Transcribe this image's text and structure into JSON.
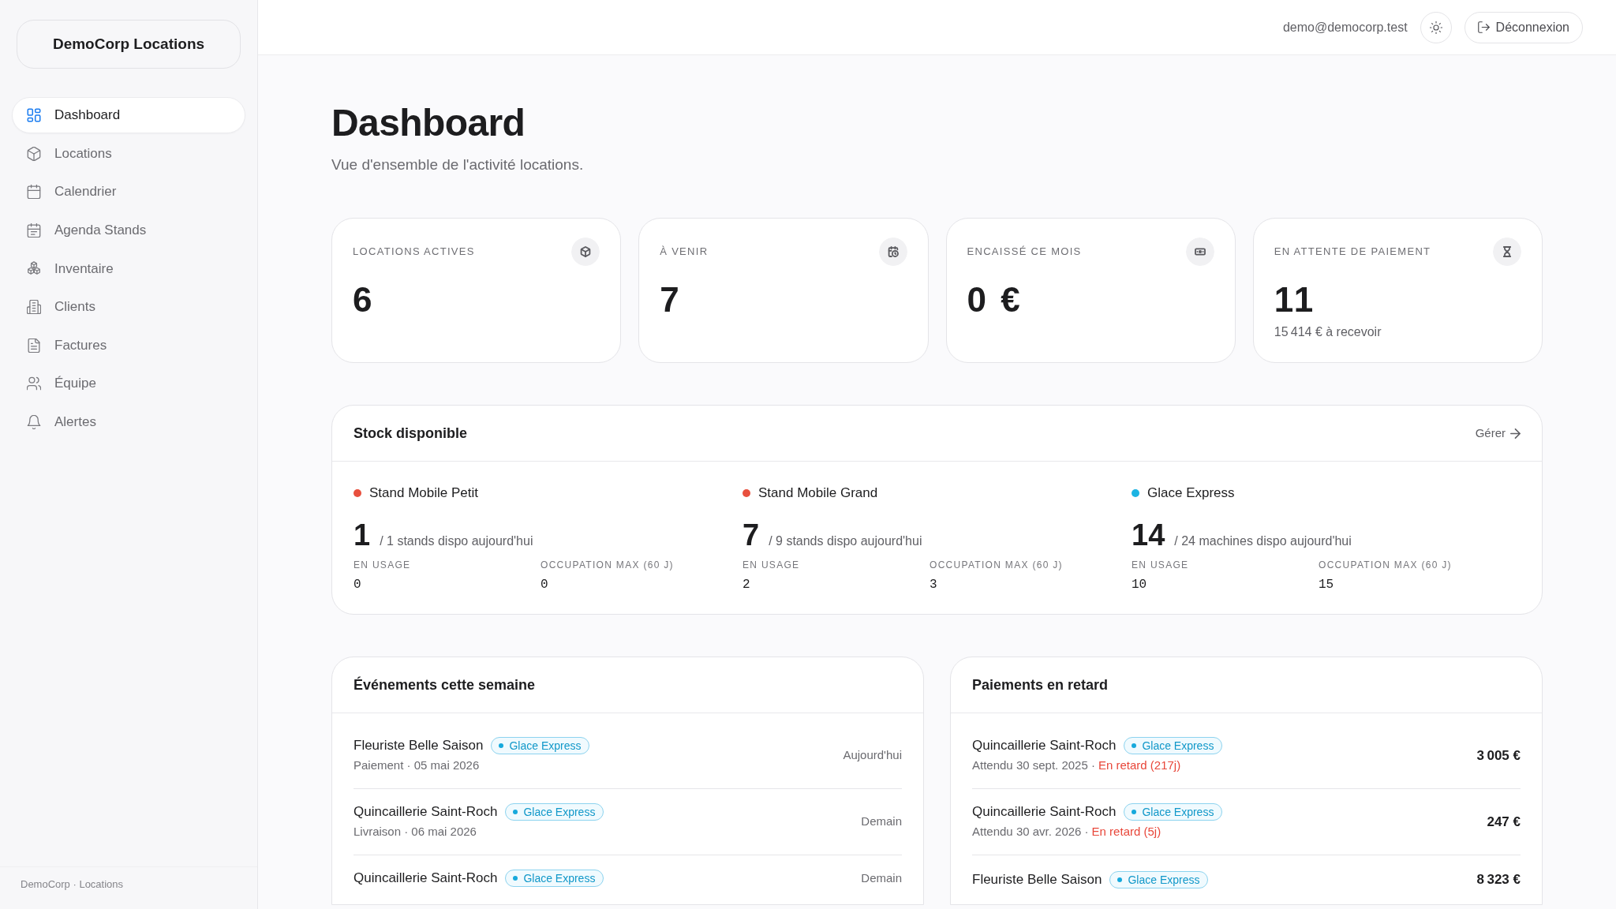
{
  "sidebar": {
    "brand": "DemoCorp Locations",
    "items": [
      {
        "label": "Dashboard",
        "selected": true
      },
      {
        "label": "Locations",
        "selected": false
      },
      {
        "label": "Calendrier",
        "selected": false
      },
      {
        "label": "Agenda Stands",
        "selected": false
      },
      {
        "label": "Inventaire",
        "selected": false
      },
      {
        "label": "Clients",
        "selected": false
      },
      {
        "label": "Factures",
        "selected": false
      },
      {
        "label": "Équipe",
        "selected": false
      },
      {
        "label": "Alertes",
        "selected": false
      }
    ],
    "footer": "DemoCorp · Locations"
  },
  "topbar": {
    "user_email": "demo@democorp.test",
    "logout_button": "Déconnexion"
  },
  "page": {
    "title": "Dashboard",
    "subtitle": "Vue d'ensemble de l'activité locations."
  },
  "stat_cards": [
    {
      "label": "LOCATIONS ACTIVES",
      "value": "6"
    },
    {
      "label": "À VENIR",
      "value": "7"
    },
    {
      "label": "ENCAISSÉ CE MOIS",
      "value": "0 €"
    },
    {
      "label": "EN ATTENTE DE PAIEMENT",
      "value": "11",
      "note": "15 414 € à recevoir"
    }
  ],
  "stock": {
    "title": "Stock disponible",
    "link": "Gérer",
    "items": [
      {
        "name": "Stand Mobile Petit",
        "color": "#e8503e",
        "available": "1",
        "capacity": "/ 1 stands dispo aujourd'hui",
        "metrics": [
          {
            "label": "EN USAGE",
            "value": "0"
          },
          {
            "label": "OCCUPATION MAX (60 J)",
            "value": "0"
          }
        ]
      },
      {
        "name": "Stand Mobile Grand",
        "color": "#e8503e",
        "available": "7",
        "capacity": "/ 9 stands dispo aujourd'hui",
        "metrics": [
          {
            "label": "EN USAGE",
            "value": "2"
          },
          {
            "label": "OCCUPATION MAX (60 J)",
            "value": "3"
          }
        ]
      },
      {
        "name": "Glace Express",
        "color": "#1cb4e3",
        "available": "14",
        "capacity": "/ 24 machines dispo aujourd'hui",
        "metrics": [
          {
            "label": "EN USAGE",
            "value": "10"
          },
          {
            "label": "OCCUPATION MAX (60 J)",
            "value": "15"
          }
        ]
      }
    ]
  },
  "events": {
    "title": "Événements cette semaine",
    "rows": [
      {
        "name": "Fleuriste Belle Saison",
        "tag": "Glace Express",
        "detail": "Paiement · 05 mai 2026",
        "when": "Aujourd'hui"
      },
      {
        "name": "Quincaillerie Saint-Roch",
        "tag": "Glace Express",
        "detail": "Livraison · 06 mai 2026",
        "when": "Demain"
      },
      {
        "name": "Quincaillerie Saint-Roch",
        "tag": "Glace Express",
        "when": "Demain"
      }
    ]
  },
  "late_payments": {
    "title": "Paiements en retard",
    "rows": [
      {
        "name": "Quincaillerie Saint-Roch",
        "tag": "Glace Express",
        "detail": "Attendu 30 sept. 2025 ·",
        "status": "En retard (217j)",
        "amount": "3 005 €"
      },
      {
        "name": "Quincaillerie Saint-Roch",
        "tag": "Glace Express",
        "detail": "Attendu 30 avr. 2026 ·",
        "status": "En retard (5j)",
        "amount": "247 €"
      },
      {
        "name": "Fleuriste Belle Saison",
        "tag": "Glace Express",
        "amount": "8 323 €"
      }
    ]
  }
}
